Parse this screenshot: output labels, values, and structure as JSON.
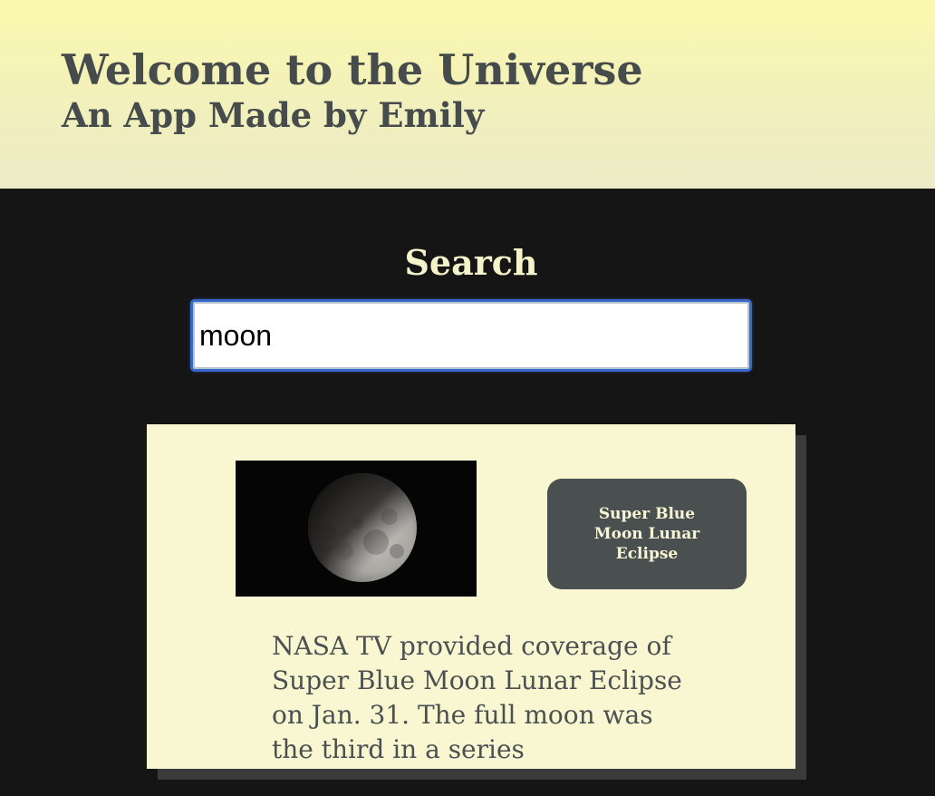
{
  "header": {
    "title": "Welcome to the Universe",
    "subtitle": "An App Made by Emily"
  },
  "search": {
    "label": "Search",
    "value": "moon"
  },
  "result": {
    "image_alt": "moon",
    "title": "Super Blue Moon Lunar Eclipse",
    "description": "NASA TV provided coverage of Super Blue Moon Lunar Eclipse on Jan. 31. The full moon was the third in a series"
  },
  "colors": {
    "header_bg": "#fbf9ae",
    "page_bg": "#151515",
    "card_bg": "#f8f7d2",
    "button_bg": "#4a4f4f",
    "text_dark": "#464b4b",
    "focus_ring": "#3a67c9"
  }
}
